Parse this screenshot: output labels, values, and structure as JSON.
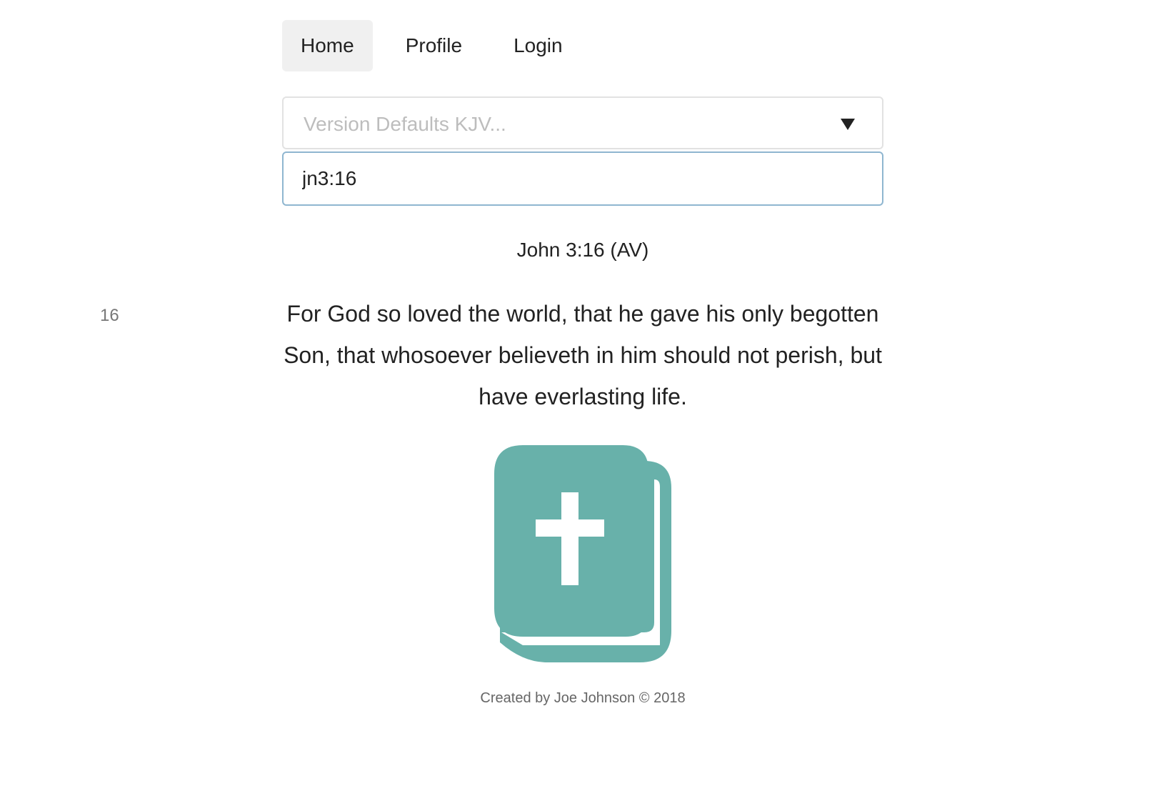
{
  "nav": {
    "items": [
      {
        "label": "Home"
      },
      {
        "label": "Profile"
      },
      {
        "label": "Login"
      }
    ]
  },
  "version_select": {
    "placeholder": "Version Defaults KJV..."
  },
  "reference_input": {
    "value": "jn3:16"
  },
  "passage": {
    "reference": "John 3:16 (AV)",
    "verse_number": "16",
    "verse_text": "For God so loved the world, that he gave his only begotten Son, that whosoever believeth in him should not perish, but have everlasting life."
  },
  "icons": {
    "logo": "bible-icon",
    "logo_color": "#68b1aa",
    "select_caret": "caret-down-icon"
  },
  "footer": {
    "text": "Created by Joe Johnson © 2018"
  }
}
